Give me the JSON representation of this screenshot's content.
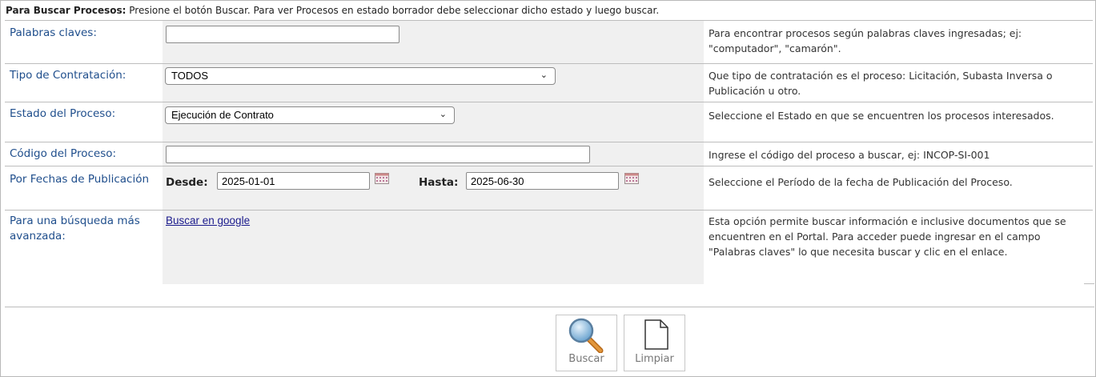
{
  "intro": {
    "bold": "Para Buscar Procesos:",
    "text": " Presione el botón Buscar. Para ver Procesos en estado borrador debe seleccionar dicho estado y luego buscar."
  },
  "fields": {
    "keywords": {
      "label": "Palabras claves:",
      "value": "",
      "help": "Para encontrar procesos según palabras claves ingresadas; ej: \"computador\", \"camarón\"."
    },
    "contract_type": {
      "label": "Tipo de Contratación:",
      "selected": "TODOS",
      "help": "Que tipo de contratación es el proceso: Licitación, Subasta Inversa o Publicación u otro."
    },
    "process_state": {
      "label": "Estado del Proceso:",
      "selected": "Ejecución de Contrato",
      "help": "Seleccione el Estado en que se encuentren los procesos interesados."
    },
    "process_code": {
      "label": "Código del Proceso:",
      "value": "",
      "help": "Ingrese el código del proceso a buscar, ej: INCOP-SI-001"
    },
    "dates": {
      "label": "Por Fechas de Publicación",
      "from_label": "Desde:",
      "from_value": "2025-01-01",
      "to_label": "Hasta:",
      "to_value": "2025-06-30",
      "help": "Seleccione el Período de la fecha de Publicación del Proceso."
    },
    "advanced": {
      "label": "Para una búsqueda más avanzada:",
      "link": "Buscar en google",
      "help": "Esta opción permite buscar información e inclusive documentos que se encuentren en el Portal. Para acceder puede ingresar en el campo \"Palabras claves\" lo que necesita buscar y clic en el enlace."
    }
  },
  "buttons": {
    "search": "Buscar",
    "clear": "Limpiar"
  },
  "icons": {
    "search": "magnifier-icon",
    "clear": "blank-document-icon",
    "calendar": "calendar-icon"
  }
}
